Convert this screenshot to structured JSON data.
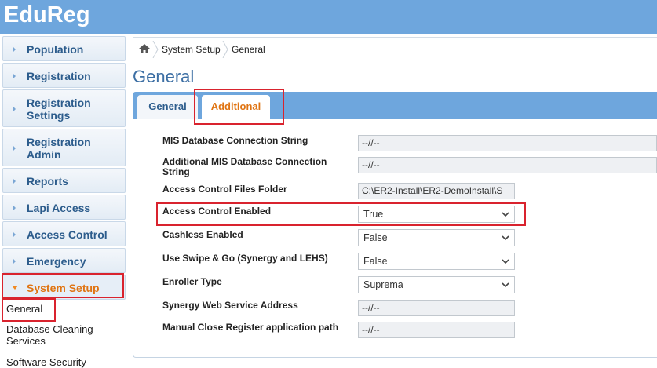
{
  "app": {
    "title": "EduReg"
  },
  "sidebar": {
    "items": [
      {
        "label": "Population"
      },
      {
        "label": "Registration"
      },
      {
        "label": "Registration Settings"
      },
      {
        "label": "Registration Admin"
      },
      {
        "label": "Reports"
      },
      {
        "label": "Lapi Access"
      },
      {
        "label": "Access Control"
      },
      {
        "label": "Emergency"
      },
      {
        "label": "System Setup"
      }
    ],
    "sub_items": [
      {
        "label": "General"
      },
      {
        "label": "Database Cleaning Services"
      },
      {
        "label": "Software Security"
      }
    ]
  },
  "breadcrumb": {
    "items": [
      "System Setup",
      "General"
    ]
  },
  "page": {
    "title": "General"
  },
  "tabs": [
    {
      "label": "General"
    },
    {
      "label": "Additional"
    }
  ],
  "fields": [
    {
      "label": "MIS Database Connection String",
      "value": "--//--"
    },
    {
      "label": "Additional MIS Database Connection String",
      "value": "--//--"
    },
    {
      "label": "Access Control Files Folder",
      "value": "C:\\ER2-Install\\ER2-DemoInstall\\S"
    },
    {
      "label": "Access Control Enabled",
      "value": "True"
    },
    {
      "label": "Cashless Enabled",
      "value": "False"
    },
    {
      "label": "Use Swipe & Go (Synergy and LEHS)",
      "value": "False"
    },
    {
      "label": "Enroller Type",
      "value": "Suprema"
    },
    {
      "label": "Synergy Web Service Address",
      "value": "--//--"
    },
    {
      "label": "Manual Close Register application path",
      "value": "--//--"
    }
  ],
  "colors": {
    "header": "#6ea6dd",
    "accent": "#e07412",
    "highlight": "#d9232e"
  }
}
